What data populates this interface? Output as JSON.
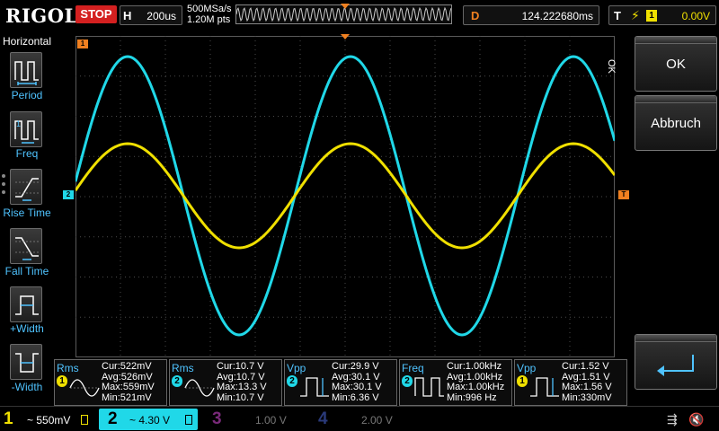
{
  "header": {
    "logo": "RIGOL",
    "run_status": "STOP",
    "horizontal_label": "H",
    "timebase": "200us",
    "sample_rate": "500MSa/s",
    "memory_depth": "1.20M pts",
    "delay_label": "D",
    "delay_value": "124.222680ms",
    "trigger_label": "T",
    "trigger_source": "1",
    "trigger_level": "0.00V"
  },
  "sidebar": {
    "title": "Horizontal",
    "items": [
      {
        "label": "Period",
        "icon": "period-icon"
      },
      {
        "label": "Freq",
        "icon": "freq-icon"
      },
      {
        "label": "Rise Time",
        "icon": "rise-time-icon"
      },
      {
        "label": "Fall Time",
        "icon": "fall-time-icon"
      },
      {
        "label": "+Width",
        "icon": "pos-width-icon"
      },
      {
        "label": "-Width",
        "icon": "neg-width-icon"
      }
    ]
  },
  "waveform": {
    "ch1_marker": "1",
    "ch2_marker": "2",
    "trigger_marker": "T"
  },
  "measurements": [
    {
      "name": "Rms",
      "channel": "1",
      "cur": "Cur:522mV",
      "avg": "Avg:526mV",
      "max": "Max:559mV",
      "min": "Min:521mV"
    },
    {
      "name": "Rms",
      "channel": "2",
      "cur": "Cur:10.7 V",
      "avg": "Avg:10.7 V",
      "max": "Max:13.3 V",
      "min": "Min:10.7 V"
    },
    {
      "name": "Vpp",
      "channel": "2",
      "cur": "Cur:29.9 V",
      "avg": "Avg:30.1 V",
      "max": "Max:30.1 V",
      "min": "Min:6.36 V"
    },
    {
      "name": "Freq",
      "channel": "2",
      "cur": "Cur:1.00kHz",
      "avg": "Avg:1.00kHz",
      "max": "Max:1.00kHz",
      "min": "Min:996 Hz"
    },
    {
      "name": "Vpp",
      "channel": "1",
      "cur": "Cur:1.52 V",
      "avg": "Avg:1.51 V",
      "max": "Max:1.56 V",
      "min": "Min:330mV"
    }
  ],
  "right_menu": {
    "vertical_label": "OK",
    "ok_label": "OK",
    "cancel_label": "Abbruch"
  },
  "channels": [
    {
      "num": "1",
      "scale": "~ 550mV",
      "color": "#f0e000"
    },
    {
      "num": "2",
      "scale": "~ 4.30 V",
      "color": "#20d8e8"
    },
    {
      "num": "3",
      "scale": "1.00 V",
      "color": "#c040c0"
    },
    {
      "num": "4",
      "scale": "2.00 V",
      "color": "#2050d0"
    }
  ],
  "colors": {
    "ch1": "#f0e000",
    "ch2": "#20d8e8",
    "trigger": "#f08020",
    "accent_label": "#4fc3ff"
  }
}
